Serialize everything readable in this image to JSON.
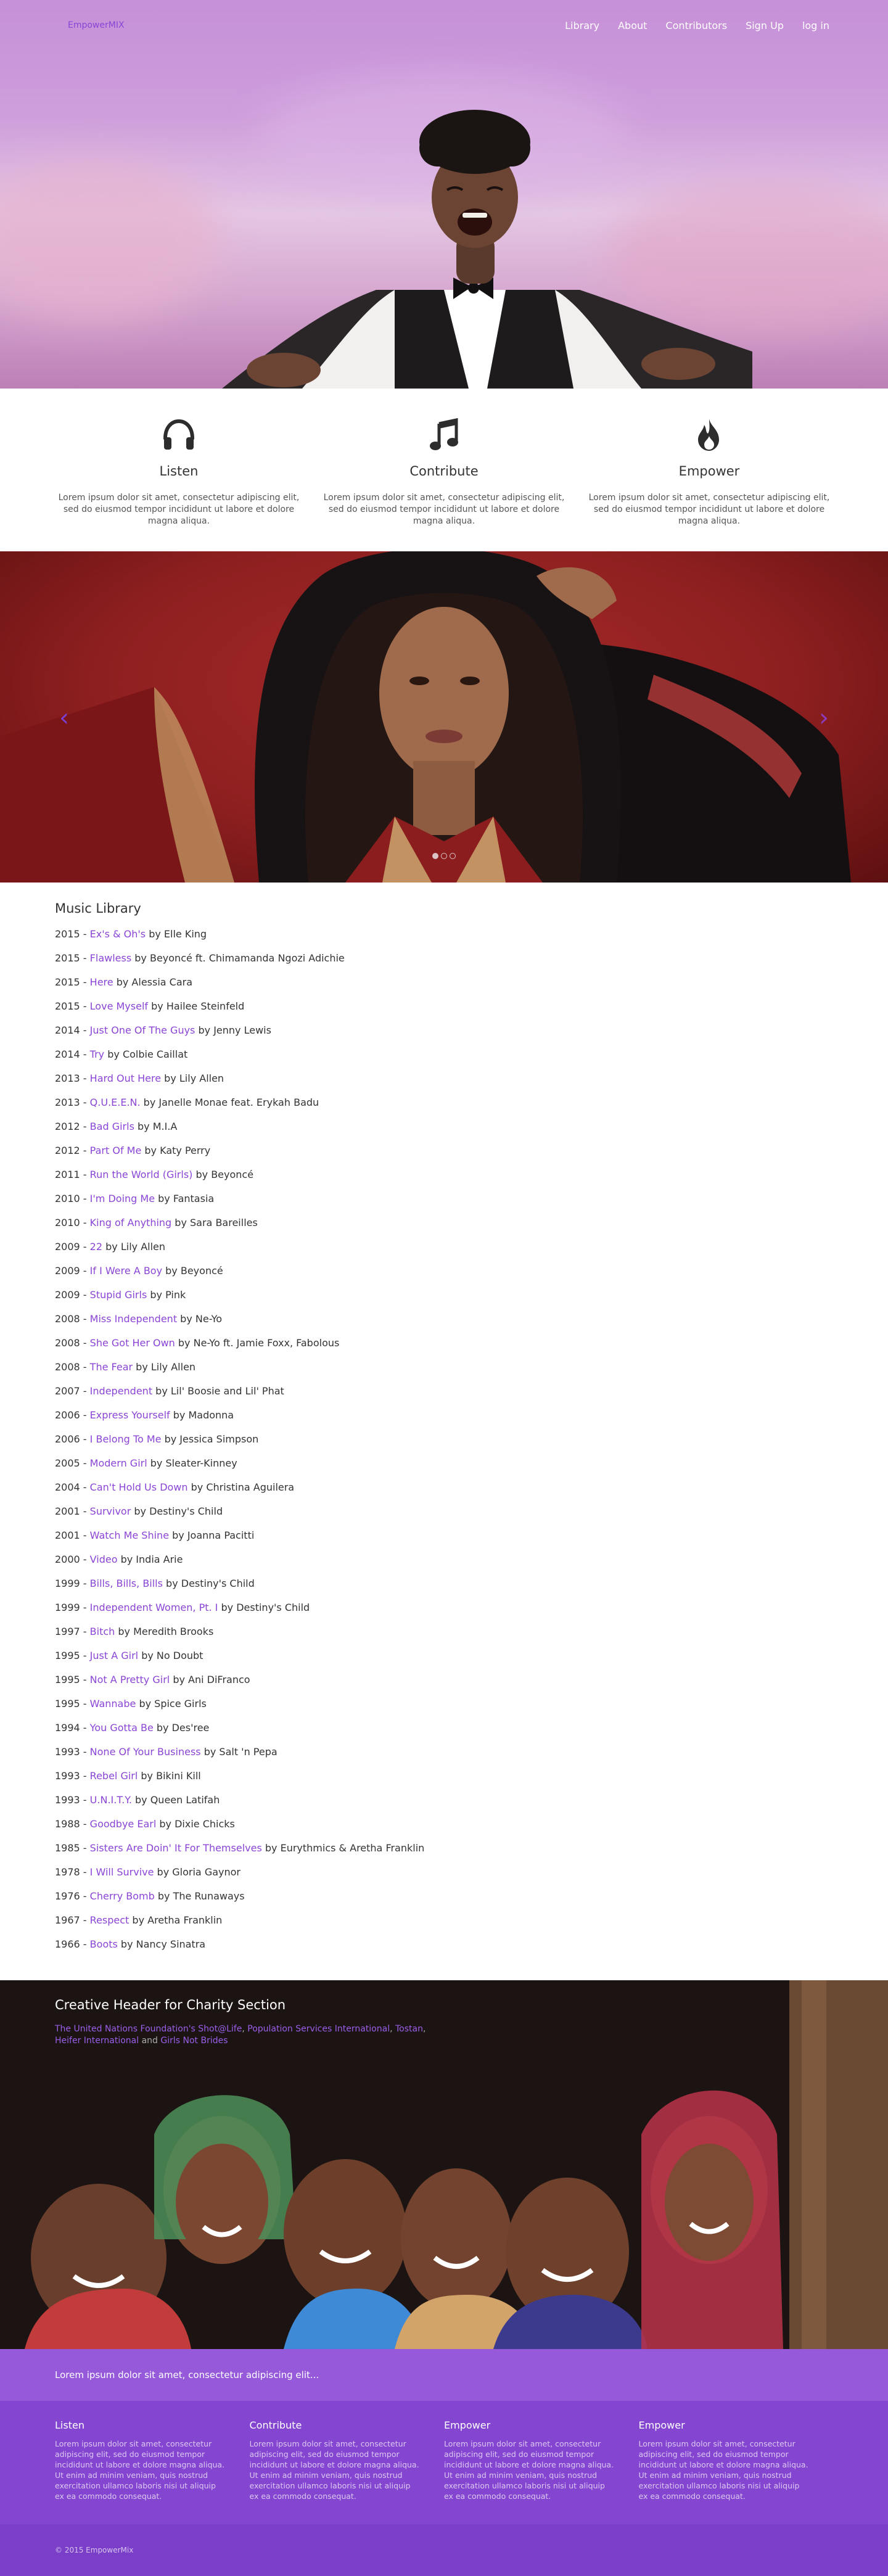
{
  "nav": {
    "brand": "EmpowerMIX",
    "links": [
      "Library",
      "About",
      "Contributors",
      "Sign Up",
      "log in"
    ]
  },
  "features": [
    {
      "icon": "headphones-icon",
      "title": "Listen",
      "text": "Lorem ipsum dolor sit amet, consectetur adipiscing elit, sed do eiusmod tempor incididunt ut labore et dolore magna aliqua."
    },
    {
      "icon": "music-note-icon",
      "title": "Contribute",
      "text": "Lorem ipsum dolor sit amet, consectetur adipiscing elit, sed do eiusmod tempor incididunt ut labore et dolore magna aliqua."
    },
    {
      "icon": "flame-icon",
      "title": "Empower",
      "text": "Lorem ipsum dolor sit amet, consectetur adipiscing elit, sed do eiusmod tempor incididunt ut labore et dolore magna aliqua."
    }
  ],
  "carousel": {
    "prev": "‹",
    "next": "›",
    "slide_count": 3,
    "active_index": 0
  },
  "library": {
    "title": "Music Library",
    "songs": [
      {
        "year": "2015",
        "title": "Ex's & Oh's",
        "artist": "Elle King"
      },
      {
        "year": "2015",
        "title": "Flawless",
        "artist": "Beyoncé ft. Chimamanda Ngozi Adichie"
      },
      {
        "year": "2015",
        "title": "Here",
        "artist": "Alessia Cara"
      },
      {
        "year": "2015",
        "title": "Love Myself",
        "artist": "Hailee Steinfeld"
      },
      {
        "year": "2014",
        "title": "Just One Of The Guys",
        "artist": "Jenny Lewis"
      },
      {
        "year": "2014",
        "title": "Try",
        "artist": "Colbie Caillat"
      },
      {
        "year": "2013",
        "title": "Hard Out Here",
        "artist": "Lily Allen"
      },
      {
        "year": "2013",
        "title": "Q.U.E.E.N.",
        "artist": "Janelle Monae feat. Erykah Badu"
      },
      {
        "year": "2012",
        "title": "Bad Girls",
        "artist": "M.I.A"
      },
      {
        "year": "2012",
        "title": "Part Of Me",
        "artist": "Katy Perry"
      },
      {
        "year": "2011",
        "title": "Run the World (Girls)",
        "artist": "Beyoncé"
      },
      {
        "year": "2010",
        "title": "I'm Doing Me",
        "artist": "Fantasia"
      },
      {
        "year": "2010",
        "title": "King of Anything",
        "artist": "Sara Bareilles"
      },
      {
        "year": "2009",
        "title": "22",
        "artist": "Lily Allen"
      },
      {
        "year": "2009",
        "title": "If I Were A Boy",
        "artist": "Beyoncé"
      },
      {
        "year": "2009",
        "title": "Stupid Girls",
        "artist": "Pink"
      },
      {
        "year": "2008",
        "title": "Miss Independent",
        "artist": "Ne-Yo"
      },
      {
        "year": "2008",
        "title": "She Got Her Own",
        "artist": "Ne-Yo ft. Jamie Foxx, Fabolous"
      },
      {
        "year": "2008",
        "title": "The Fear",
        "artist": "Lily Allen"
      },
      {
        "year": "2007",
        "title": "Independent",
        "artist": "Lil' Boosie and Lil' Phat"
      },
      {
        "year": "2006",
        "title": "Express Yourself",
        "artist": "Madonna"
      },
      {
        "year": "2006",
        "title": "I Belong To Me",
        "artist": "Jessica Simpson"
      },
      {
        "year": "2005",
        "title": "Modern Girl",
        "artist": "Sleater-Kinney"
      },
      {
        "year": "2004",
        "title": "Can't Hold Us Down",
        "artist": "Christina Aguilera"
      },
      {
        "year": "2001",
        "title": "Survivor",
        "artist": "Destiny's Child"
      },
      {
        "year": "2001",
        "title": "Watch Me Shine",
        "artist": "Joanna Pacitti"
      },
      {
        "year": "2000",
        "title": "Video",
        "artist": "India Arie"
      },
      {
        "year": "1999",
        "title": "Bills, Bills, Bills",
        "artist": "Destiny's Child"
      },
      {
        "year": "1999",
        "title": "Independent Women, Pt. I",
        "artist": "Destiny's Child"
      },
      {
        "year": "1997",
        "title": "Bitch",
        "artist": "Meredith Brooks"
      },
      {
        "year": "1995",
        "title": "Just A Girl",
        "artist": "No Doubt"
      },
      {
        "year": "1995",
        "title": "Not A Pretty Girl",
        "artist": "Ani DiFranco"
      },
      {
        "year": "1995",
        "title": "Wannabe",
        "artist": "Spice Girls"
      },
      {
        "year": "1994",
        "title": "You Gotta Be",
        "artist": "Des'ree"
      },
      {
        "year": "1993",
        "title": "None Of Your Business",
        "artist": "Salt 'n Pepa"
      },
      {
        "year": "1993",
        "title": "Rebel Girl",
        "artist": "Bikini Kill"
      },
      {
        "year": "1993",
        "title": "U.N.I.T.Y.",
        "artist": "Queen Latifah"
      },
      {
        "year": "1988",
        "title": "Goodbye Earl",
        "artist": "Dixie Chicks"
      },
      {
        "year": "1985",
        "title": "Sisters Are Doin' It For Themselves",
        "artist": "Eurythmics & Aretha Franklin"
      },
      {
        "year": "1978",
        "title": "I Will Survive",
        "artist": "Gloria Gaynor"
      },
      {
        "year": "1976",
        "title": "Cherry Bomb",
        "artist": "The Runaways"
      },
      {
        "year": "1967",
        "title": "Respect",
        "artist": "Aretha Franklin"
      },
      {
        "year": "1966",
        "title": "Boots",
        "artist": "Nancy Sinatra"
      }
    ]
  },
  "charity": {
    "title": "Creative Header for Charity Section",
    "links": [
      {
        "text": "The United Nations Foundation's Shot@Life",
        "sep": ", "
      },
      {
        "text": "Population Services International",
        "sep": ", "
      },
      {
        "text": "Tostan",
        "sep": ", "
      },
      {
        "text": "Heifer International",
        "sep": " and "
      },
      {
        "text": "Girls Not Brides",
        "sep": ""
      }
    ]
  },
  "band": {
    "text": "Lorem ipsum dolor sit amet, consectetur adipiscing elit..."
  },
  "footer": {
    "columns": [
      {
        "title": "Listen",
        "text": "Lorem ipsum dolor sit amet, consectetur adipiscing elit, sed do eiusmod tempor incididunt ut labore et dolore magna aliqua. Ut enim ad minim veniam, quis nostrud exercitation ullamco laboris nisi ut aliquip ex ea commodo consequat."
      },
      {
        "title": "Contribute",
        "text": "Lorem ipsum dolor sit amet, consectetur adipiscing elit, sed do eiusmod tempor incididunt ut labore et dolore magna aliqua. Ut enim ad minim veniam, quis nostrud exercitation ullamco laboris nisi ut aliquip ex ea commodo consequat."
      },
      {
        "title": "Empower",
        "text": "Lorem ipsum dolor sit amet, consectetur adipiscing elit, sed do eiusmod tempor incididunt ut labore et dolore magna aliqua. Ut enim ad minim veniam, quis nostrud exercitation ullamco laboris nisi ut aliquip ex ea commodo consequat."
      },
      {
        "title": "Empower",
        "text": "Lorem ipsum dolor sit amet, consectetur adipiscing elit, sed do eiusmod tempor incididunt ut labore et dolore magna aliqua. Ut enim ad minim veniam, quis nostrud exercitation ullamco laboris nisi ut aliquip ex ea commodo consequat."
      }
    ],
    "copyright": "© 2015 EmpowerMix"
  },
  "colors": {
    "accent": "#8a45d6",
    "band": "#9559d9",
    "footer": "#8446d1",
    "footer_bottom": "#7a3ec8"
  }
}
